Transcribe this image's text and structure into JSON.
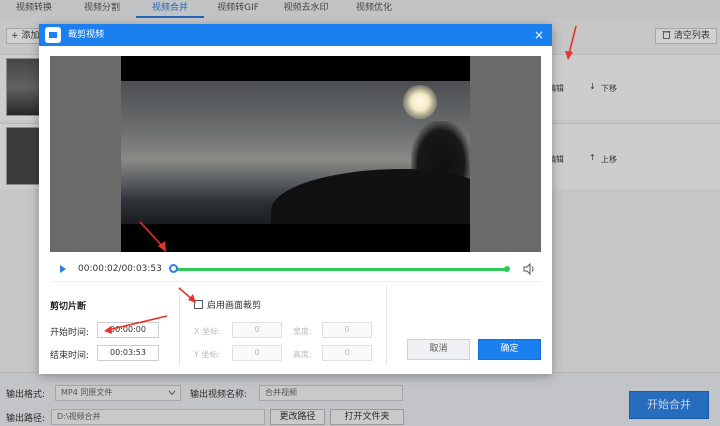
{
  "tabs": [
    "视频转换",
    "视频分割",
    "视频合并",
    "视频转GIF",
    "视频去水印",
    "视频优化"
  ],
  "active_tab": "视频合并",
  "toolbar": {
    "add_label": "+ 添加",
    "clear_label": "清空列表"
  },
  "rows": [
    {
      "edit_label": "编辑",
      "move_label": "下移",
      "move_arrow": "↓"
    },
    {
      "edit_label": "编辑",
      "move_label": "上移",
      "move_arrow": "↑"
    }
  ],
  "bottom": {
    "format_label": "输出格式:",
    "format_value": "MP4 同原文件",
    "name_label": "输出视频名称:",
    "name_value": "合并视频",
    "path_label": "输出路径:",
    "path_value": "D:\\视频合并",
    "change_path_label": "更改路径",
    "open_folder_label": "打开文件夹",
    "start_label": "开始合并"
  },
  "modal": {
    "title": "裁剪视频",
    "close_glyph": "×",
    "time_display": "00:00:02/00:03:53",
    "clip_section_title": "剪切片断",
    "start_label": "开始时间:",
    "start_value": "00:00:00",
    "end_label": "结束时间:",
    "end_value": "00:03:53",
    "crop_checkbox_label": "启用画面裁剪",
    "crop_x_label": "X 坐标:",
    "crop_y_label": "Y 坐标:",
    "crop_w_label": "宽度:",
    "crop_h_label": "高度:",
    "crop_x": "0",
    "crop_y": "0",
    "crop_w": "0",
    "crop_h": "0",
    "cancel_label": "取消",
    "ok_label": "确定"
  },
  "colors": {
    "accent": "#1a80f0",
    "track": "#2ecb5a",
    "annotation": "#e8332a"
  },
  "icons": {
    "play": "play-icon",
    "volume": "volume-icon",
    "trash": "trash-icon"
  }
}
